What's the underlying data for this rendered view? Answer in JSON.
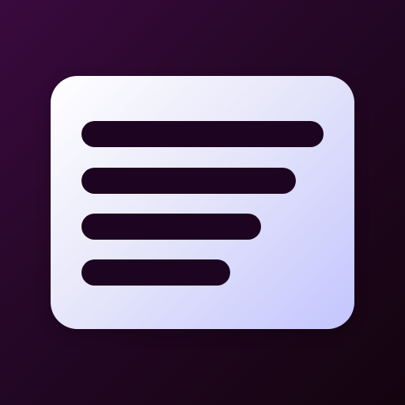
{
  "icon": {
    "name": "text-lines-icon",
    "background_colors": [
      "#3a0a3e",
      "#240726",
      "#14040f"
    ],
    "card_colors": [
      "#ffffff",
      "#e7e7fa",
      "#c3c5fe"
    ],
    "line_color": "#1d0420",
    "lines": [
      {
        "name": "line-1"
      },
      {
        "name": "line-2"
      },
      {
        "name": "line-3"
      },
      {
        "name": "line-4"
      }
    ]
  }
}
